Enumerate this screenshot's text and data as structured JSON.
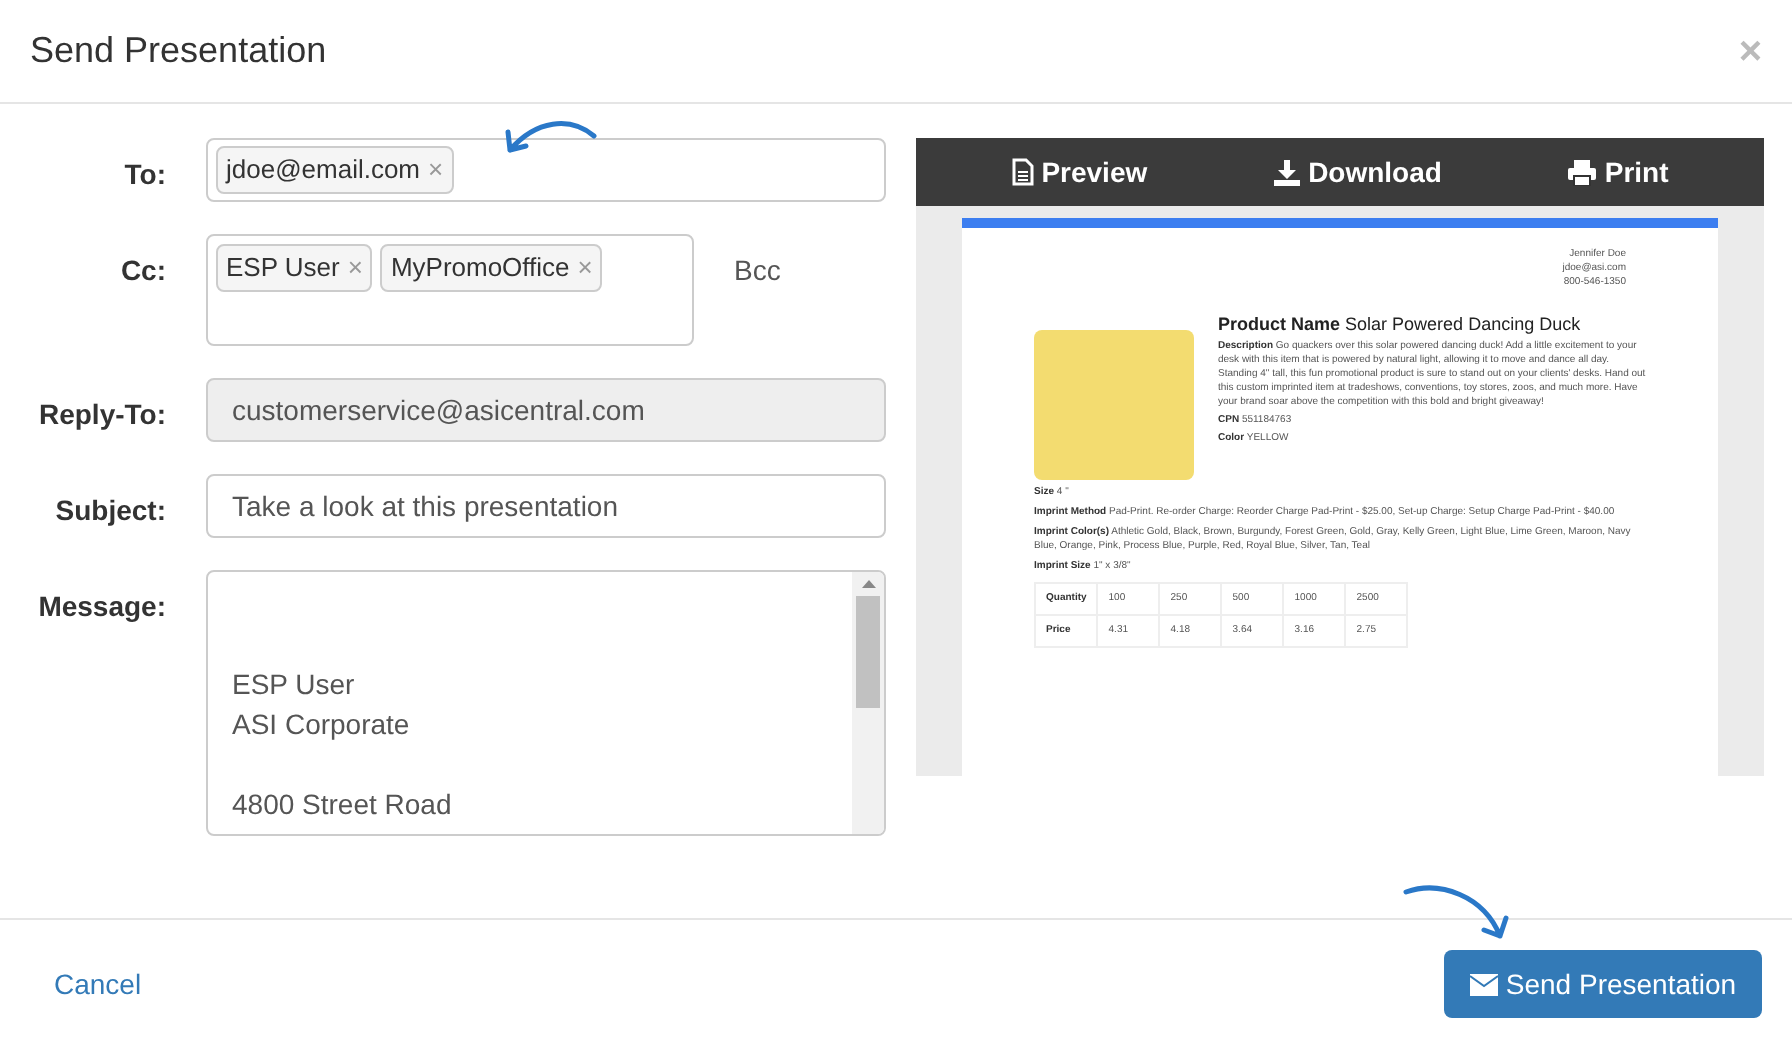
{
  "window": {
    "title": "Send Presentation",
    "close": "×"
  },
  "form": {
    "to": {
      "label": "To:",
      "chips": [
        {
          "text": "jdoe@email.com",
          "remove": "×"
        }
      ]
    },
    "cc": {
      "label": "Cc:",
      "chips": [
        {
          "text": "ESP User",
          "remove": "×"
        },
        {
          "text": "MyPromoOffice",
          "remove": "×"
        }
      ],
      "bcc": "Bcc"
    },
    "reply_to": {
      "label": "Reply-To:",
      "value": "customerservice@asicentral.com",
      "disabled": true
    },
    "subject": {
      "label": "Subject:",
      "value": "Take a look at this presentation"
    },
    "message": {
      "label": "Message:",
      "paragraphs": [
        [
          "ESP User",
          "ASI Corporate"
        ],
        [
          "4800 Street Road"
        ]
      ]
    }
  },
  "preview": {
    "toolbar": [
      "Preview",
      "Download",
      "Print"
    ],
    "contact": [
      "Jennifer Doe",
      "jdoe@asi.com",
      "800-546-1350"
    ],
    "product_label": "Product Name",
    "product_name": "Solar Powered Dancing Duck",
    "fields": [
      {
        "label": "Description",
        "value": "Go quackers over this solar powered dancing duck! Add a little excitement to your desk with this item that is powered by natural light, allowing it to move and dance all day. Standing 4\" tall, this fun promotional product is sure to stand out on your clients' desks. Hand out this custom imprinted item at tradeshows, conventions, toy stores, zoos, and much more. Have your brand soar above the competition with this bold and bright giveaway!"
      },
      {
        "label": "CPN",
        "value": "551184763"
      },
      {
        "label": "Color",
        "value": "YELLOW"
      }
    ],
    "details": [
      {
        "label": "Size",
        "value": "4 \""
      },
      {
        "label": "Imprint Method",
        "value": "Pad-Print. Re-order Charge: Reorder Charge Pad-Print - $25.00, Set-up Charge: Setup Charge Pad-Print - $40.00"
      },
      {
        "label": "Imprint Color(s)",
        "value": "Athletic Gold, Black, Brown, Burgundy, Forest Green, Gold, Gray, Kelly Green, Light Blue, Lime Green, Maroon, Navy Blue, Orange, Pink, Process Blue, Purple, Red, Royal Blue, Silver, Tan, Teal"
      },
      {
        "label": "Imprint Size",
        "value": "1\" x 3/8\""
      }
    ],
    "price_table": [
      [
        "Quantity",
        "100",
        "250",
        "500",
        "1000",
        "2500"
      ],
      [
        "Price",
        "4.31",
        "4.18",
        "3.64",
        "3.16",
        "2.75"
      ]
    ]
  },
  "footer": {
    "cancel": "Cancel",
    "send": "Send Presentation"
  }
}
